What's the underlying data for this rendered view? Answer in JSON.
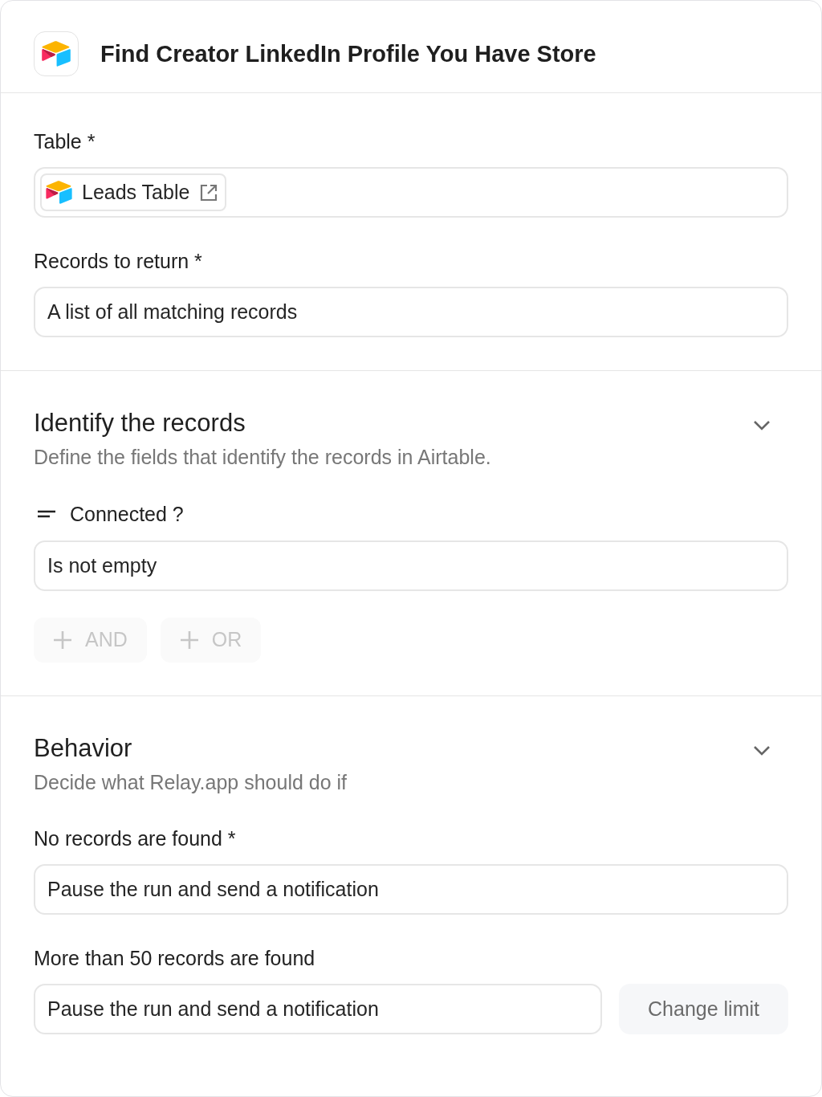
{
  "header": {
    "title": "Find Creator LinkedIn Profile You Have Store"
  },
  "sections": [
    {
      "fields": [
        {
          "label": "Table *",
          "kind": "chip",
          "value": "Leads Table"
        },
        {
          "label": "Records to return *",
          "kind": "select",
          "value": "A list of all matching records"
        }
      ]
    },
    {
      "title": "Identify the records",
      "subtitle": "Define the fields that identify the records in Airtable.",
      "conditions": [
        {
          "field": "Connected ?",
          "value": "Is not empty"
        }
      ],
      "buttons": [
        {
          "label": "AND",
          "disabled": true
        },
        {
          "label": "OR",
          "disabled": true
        }
      ]
    },
    {
      "title": "Behavior",
      "subtitle": "Decide what Relay.app should do if",
      "fields": [
        {
          "label": "No records are found *",
          "kind": "select",
          "value": "Pause the run and send a notification"
        },
        {
          "label": "More than 50 records are found",
          "kind": "select",
          "value": "Pause the run and send a notification",
          "action": {
            "label": "Change limit"
          }
        }
      ]
    }
  ]
}
